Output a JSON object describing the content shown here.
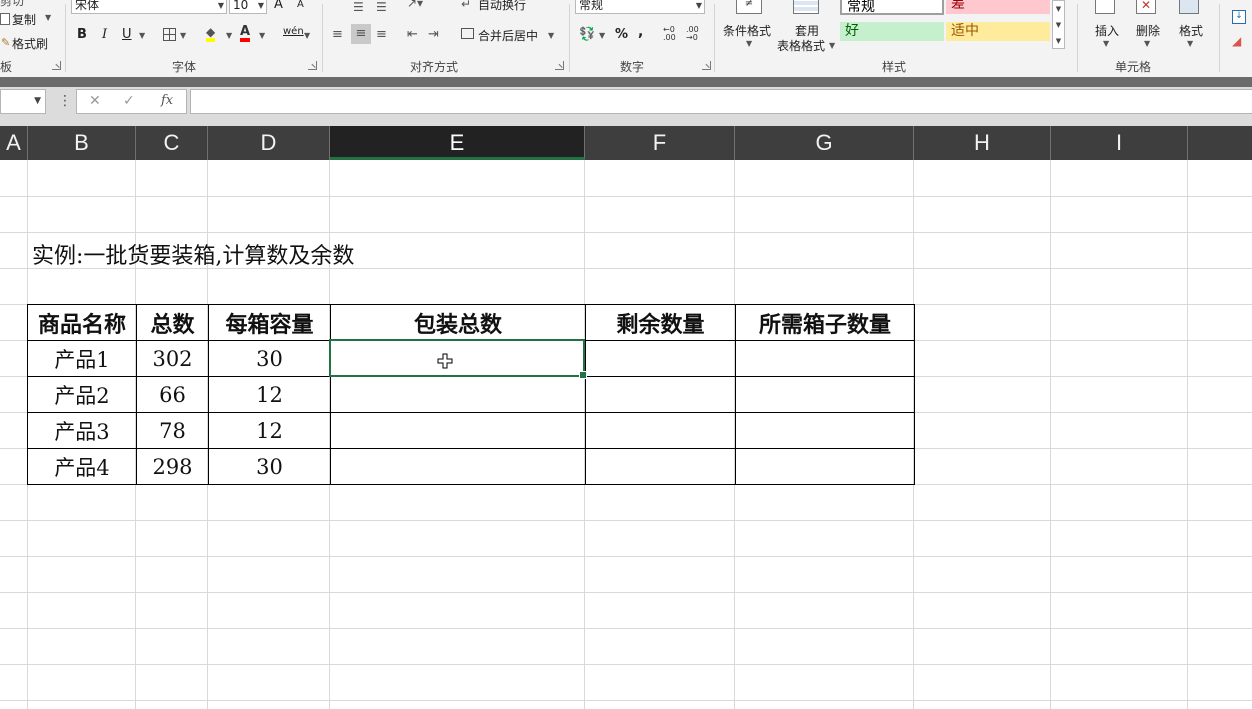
{
  "ribbon": {
    "clipboard": {
      "cut_label": "剪切",
      "copy_label": "复制",
      "format_painter_label": "格式刷",
      "group_label": "板"
    },
    "font": {
      "font_name": "宋体",
      "font_size": "10",
      "grow_label": "A",
      "shrink_label": "A",
      "bold_label": "B",
      "italic_label": "I",
      "underline_label": "U",
      "phonetic_label": "wén",
      "group_label": "字体"
    },
    "alignment": {
      "wrap_label": "自动换行",
      "merge_label": "合并后居中",
      "group_label": "对齐方式"
    },
    "number": {
      "format_value": "常规",
      "percent_label": "%",
      "comma_label": ",",
      "group_label": "数字"
    },
    "styles": {
      "cond_format_label": "条件格式",
      "table_format_label_1": "套用",
      "table_format_label_2": "表格格式",
      "normal_label": "常规",
      "bad_label": "差",
      "good_label": "好",
      "neutral_label": "适中",
      "group_label": "样式"
    },
    "cells": {
      "insert_label": "插入",
      "delete_label": "删除",
      "format_label": "格式",
      "group_label": "单元格"
    }
  },
  "formula_bar": {
    "name_box": "",
    "fx_label": "fx",
    "formula": ""
  },
  "columns": [
    "A",
    "B",
    "C",
    "D",
    "E",
    "F",
    "G",
    "H",
    "I"
  ],
  "selected_column": "E",
  "sheet": {
    "title": "实例:一批货要装箱,计算数及余数",
    "headers": [
      "商品名称",
      "总数",
      "每箱容量",
      "包装总数",
      "剩余数量",
      "所需箱子数量"
    ],
    "rows": [
      [
        "产品1",
        "302",
        "30",
        "",
        "",
        ""
      ],
      [
        "产品2",
        "66",
        "12",
        "",
        "",
        ""
      ],
      [
        "产品3",
        "78",
        "12",
        "",
        "",
        ""
      ],
      [
        "产品4",
        "298",
        "30",
        "",
        "",
        ""
      ]
    ]
  },
  "colors": {
    "accent": "#217346",
    "bad_bg": "#ffc7ce",
    "bad_fg": "#9c0006",
    "good_bg": "#c6efce",
    "good_fg": "#006100",
    "neutral_bg": "#ffeb9c",
    "neutral_fg": "#9c5700"
  }
}
